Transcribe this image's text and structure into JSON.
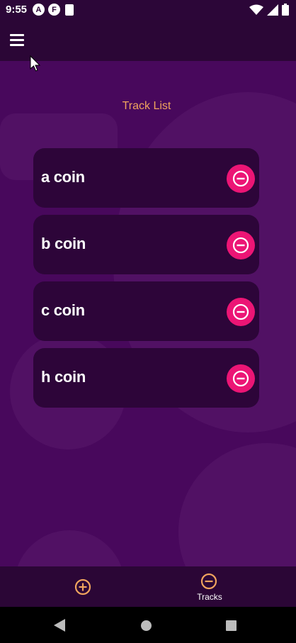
{
  "status_bar": {
    "time": "9:55",
    "left_icons": [
      "a-badge-icon",
      "f-badge-icon",
      "sd-card-icon"
    ],
    "badge_a": "A",
    "badge_f": "F",
    "right_icons": [
      "wifi-icon",
      "cellular-signal-icon",
      "battery-icon"
    ]
  },
  "app_bar": {
    "menu_icon": "hamburger-menu-icon"
  },
  "page": {
    "title": "Track List"
  },
  "tracks": [
    {
      "name": "a coin",
      "action_icon": "remove-circle-icon"
    },
    {
      "name": "b coin",
      "action_icon": "remove-circle-icon"
    },
    {
      "name": "c coin",
      "action_icon": "remove-circle-icon"
    },
    {
      "name": "h coin",
      "action_icon": "remove-circle-icon"
    }
  ],
  "bottom_nav": {
    "add_icon": "add-circle-icon",
    "tracks_icon": "remove-circle-outline-icon",
    "tracks_label": "Tracks"
  },
  "system_nav": {
    "items": [
      "back-icon",
      "home-icon",
      "recents-icon"
    ]
  },
  "colors": {
    "background": "#48085c",
    "app_bar": "#2b0636",
    "card": "#2d0539",
    "accent_orange": "#f0a45e",
    "remove_pink": "#ec1575",
    "text": "#ffffff"
  }
}
